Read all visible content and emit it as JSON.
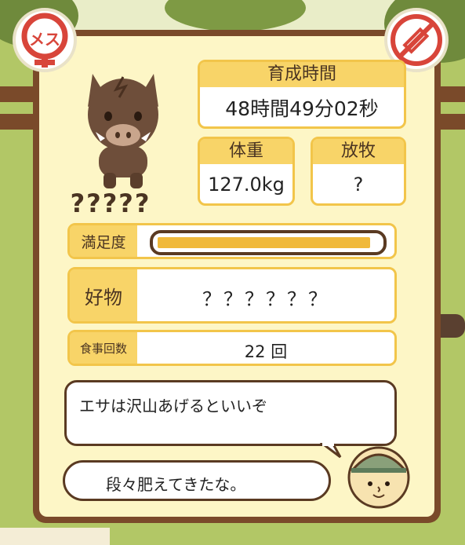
{
  "boar": {
    "name": "?????",
    "sex_badge_text": "メス",
    "sex_icon": "female-symbol-icon",
    "medicine_icon": "no-syringe-icon",
    "portrait_icon": "wild-boar-icon"
  },
  "stats": {
    "raise_time_label": "育成時間",
    "raise_time_value": "48時間49分02秒",
    "weight_label": "体重",
    "weight_value": "127.0kg",
    "grazing_label": "放牧",
    "grazing_value": "?",
    "satisfaction_label": "満足度",
    "satisfaction_level": 0.96,
    "favorite_label": "好物",
    "favorite_value": "？？？？？？",
    "meals_label": "食事回数",
    "meals_value": "22 回"
  },
  "dialogue": {
    "hint": "エサは沢山あげるといいぞ",
    "comment": "段々肥えてきたな。",
    "speaker_icon": "farmer-face-icon"
  },
  "colors": {
    "frame_brown": "#7a4a2a",
    "panel_cream": "#fdf6c6",
    "label_yellow": "#f8d468",
    "bar_fill": "#f0b93a",
    "badge_red": "#d8453a"
  }
}
